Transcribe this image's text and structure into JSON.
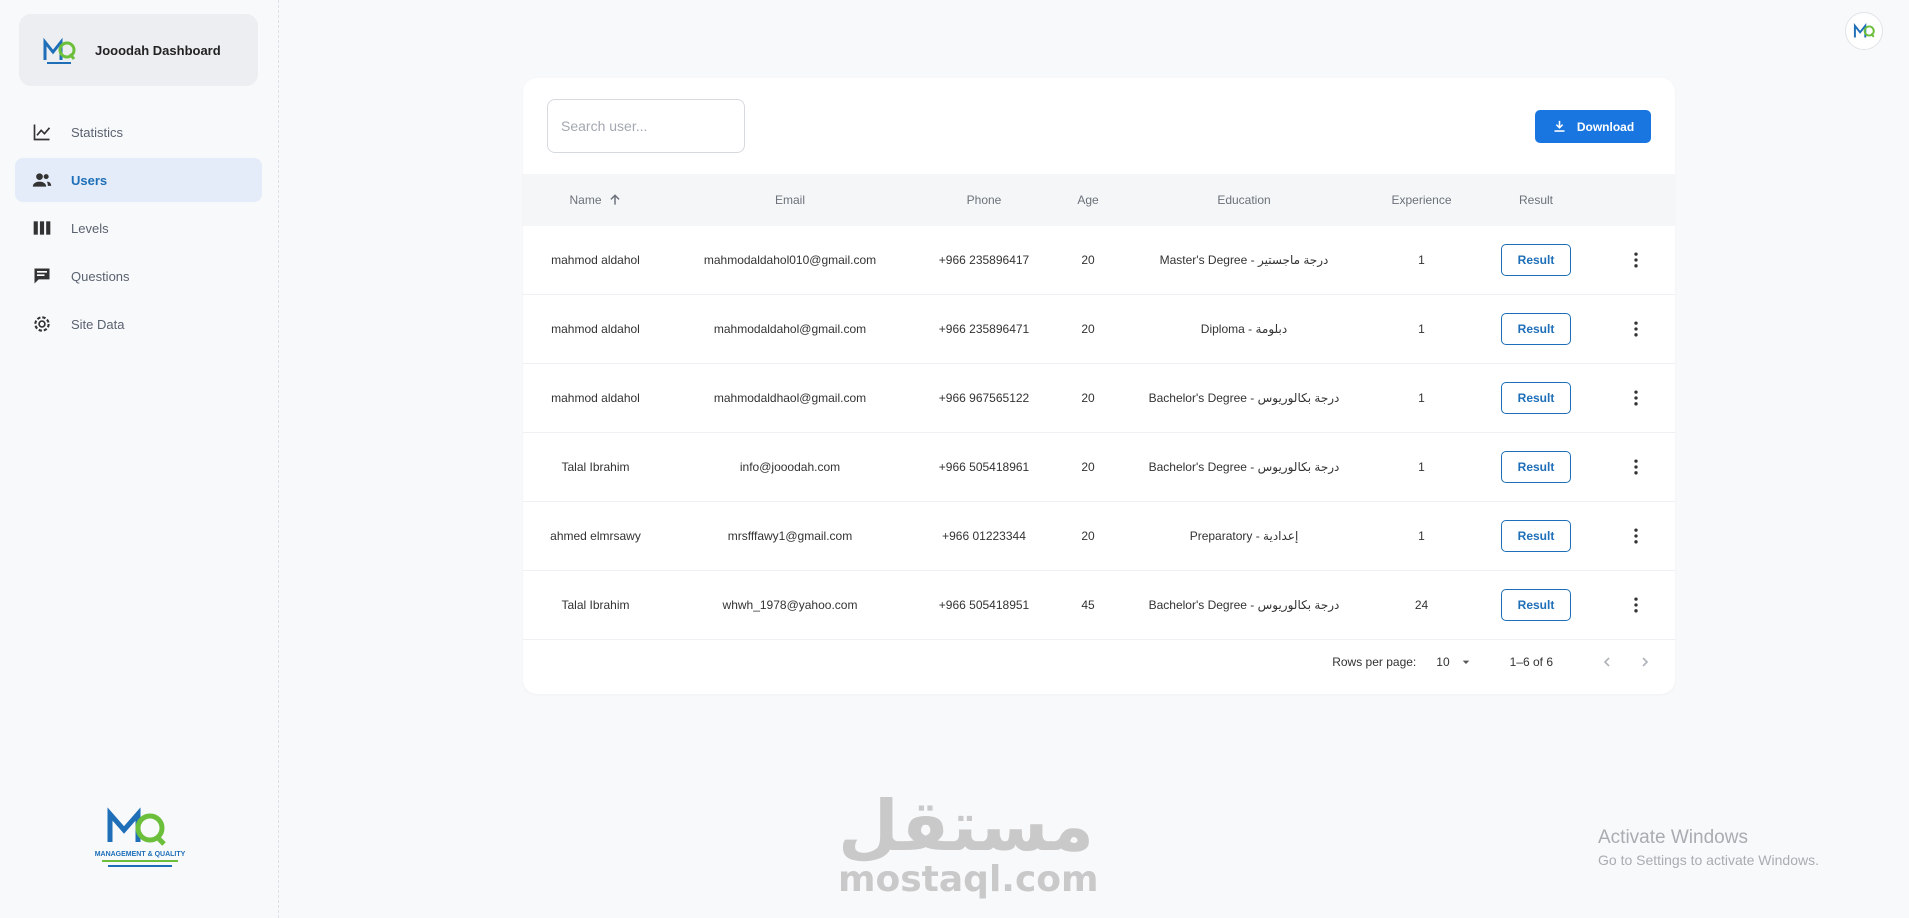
{
  "app": {
    "title": "Jooodah Dashboard",
    "accent_color": "#1976e0"
  },
  "sidebar": {
    "items": [
      {
        "label": "Statistics",
        "icon": "chart-line-icon",
        "active": false
      },
      {
        "label": "Users",
        "icon": "users-icon",
        "active": true
      },
      {
        "label": "Levels",
        "icon": "columns-icon",
        "active": false
      },
      {
        "label": "Questions",
        "icon": "comment-icon",
        "active": false
      },
      {
        "label": "Site Data",
        "icon": "gear-icon",
        "active": false
      }
    ],
    "logo_text": "MANAGEMENT & QUALITY"
  },
  "toolbar": {
    "search_placeholder": "Search user...",
    "download_label": "Download"
  },
  "table": {
    "columns": [
      "Name",
      "Email",
      "Phone",
      "Age",
      "Education",
      "Experience",
      "Result"
    ],
    "sorted_column": "Name",
    "rows": [
      {
        "name": "mahmod aldahol",
        "email": "mahmodaldahol010@gmail.com",
        "phone": "+966 235896417",
        "age": "20",
        "education": "Master's Degree - درجة ماجستير",
        "experience": "1",
        "result": "Result"
      },
      {
        "name": "mahmod aldahol",
        "email": "mahmodaldahol@gmail.com",
        "phone": "+966 235896471",
        "age": "20",
        "education": "Diploma - دبلومة",
        "experience": "1",
        "result": "Result"
      },
      {
        "name": "mahmod aldahol",
        "email": "mahmodaldhaol@gmail.com",
        "phone": "+966 967565122",
        "age": "20",
        "education": "Bachelor's Degree - درجة بكالوريوس",
        "experience": "1",
        "result": "Result"
      },
      {
        "name": "Talal Ibrahim",
        "email": "info@jooodah.com",
        "phone": "+966 505418961",
        "age": "20",
        "education": "Bachelor's Degree - درجة بكالوريوس",
        "experience": "1",
        "result": "Result"
      },
      {
        "name": "ahmed elmrsawy",
        "email": "mrsfffawy1@gmail.com",
        "phone": "+966 01223344",
        "age": "20",
        "education": "Preparatory - إعدادية",
        "experience": "1",
        "result": "Result"
      },
      {
        "name": "Talal Ibrahim",
        "email": "whwh_1978@yahoo.com",
        "phone": "+966 505418951",
        "age": "45",
        "education": "Bachelor's Degree - درجة بكالوريوس",
        "experience": "24",
        "result": "Result"
      }
    ]
  },
  "pagination": {
    "rows_per_page_label": "Rows per page:",
    "rows_per_page_value": "10",
    "range": "1–6 of 6"
  },
  "watermarks": {
    "mostaql_arabic": "مستقل",
    "mostaql_latin": "mostaql.com",
    "activate_title": "Activate Windows",
    "activate_sub": "Go to Settings to activate Windows."
  }
}
